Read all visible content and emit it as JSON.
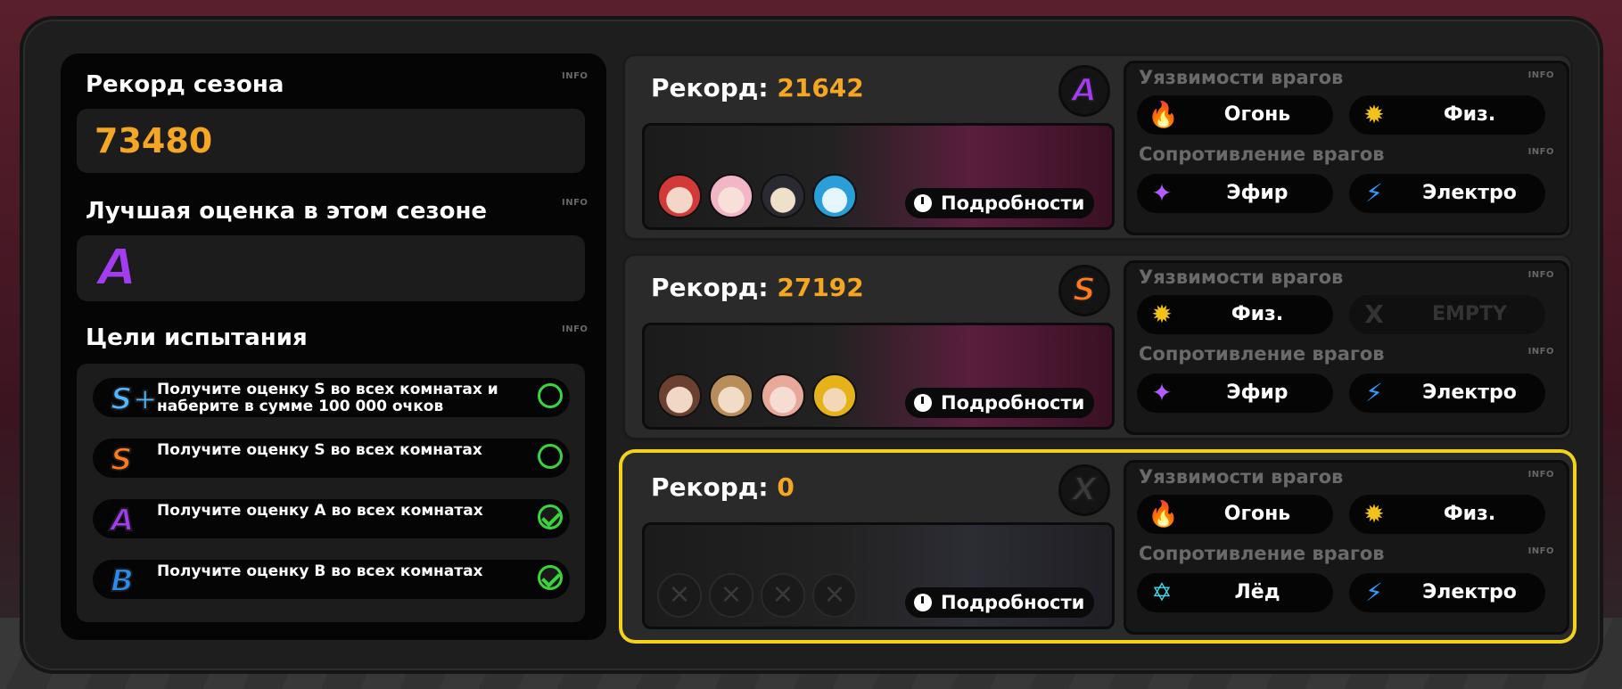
{
  "info_label": "INFO",
  "season": {
    "record_title": "Рекорд сезона",
    "record_value": "73480",
    "best_grade_title": "Лучшая оценка в этом сезоне",
    "best_grade": "A",
    "goals_title": "Цели испытания",
    "goals": [
      {
        "grade": "S+",
        "text": "Получите оценку S во всех комнатах и наберите в сумме 100 000 очков",
        "done": false
      },
      {
        "grade": "S",
        "text": "Получите оценку S во всех комнатах",
        "done": false
      },
      {
        "grade": "A",
        "text": "Получите оценку A во всех комнатах",
        "done": true
      },
      {
        "grade": "B",
        "text": "Получите оценку B во всех комнатах",
        "done": true
      }
    ]
  },
  "rooms": [
    {
      "record_label": "Рекорд:",
      "record_value": "21642",
      "grade": "A",
      "details_label": "Подробности",
      "weak_title": "Уязвимости врагов",
      "weak": [
        {
          "icon": "fire-icon",
          "label": "Огонь",
          "color": "#ff5a1f"
        },
        {
          "icon": "physical-icon",
          "label": "Физ.",
          "color": "#f2c21b"
        }
      ],
      "resist_title": "Сопротивление врагов",
      "resist": [
        {
          "icon": "ether-icon",
          "label": "Эфир",
          "color": "#b55cff"
        },
        {
          "icon": "electric-icon",
          "label": "Электро",
          "color": "#2a9cff"
        }
      ]
    },
    {
      "record_label": "Рекорд:",
      "record_value": "27192",
      "grade": "S",
      "details_label": "Подробности",
      "weak_title": "Уязвимости врагов",
      "weak": [
        {
          "icon": "physical-icon",
          "label": "Физ.",
          "color": "#f2c21b"
        },
        {
          "icon": "empty-icon",
          "label": "EMPTY",
          "color": "#333333"
        }
      ],
      "resist_title": "Сопротивление врагов",
      "resist": [
        {
          "icon": "ether-icon",
          "label": "Эфир",
          "color": "#b55cff"
        },
        {
          "icon": "electric-icon",
          "label": "Электро",
          "color": "#2a9cff"
        }
      ]
    },
    {
      "record_label": "Рекорд:",
      "record_value": "0",
      "grade": "X",
      "details_label": "Подробности",
      "weak_title": "Уязвимости врагов",
      "weak": [
        {
          "icon": "fire-icon",
          "label": "Огонь",
          "color": "#ff5a1f"
        },
        {
          "icon": "physical-icon",
          "label": "Физ.",
          "color": "#f2c21b"
        }
      ],
      "resist_title": "Сопротивление врагов",
      "resist": [
        {
          "icon": "ice-icon",
          "label": "Лёд",
          "color": "#3fd8e8"
        },
        {
          "icon": "electric-icon",
          "label": "Электро",
          "color": "#2a9cff"
        }
      ]
    }
  ]
}
